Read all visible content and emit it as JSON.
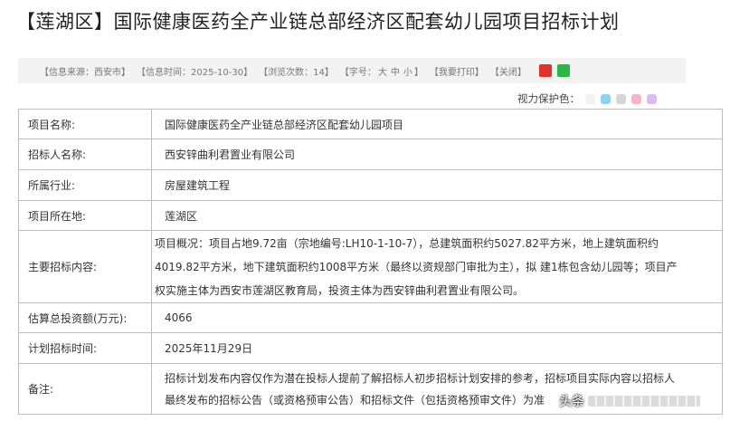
{
  "title": "【莲湖区】国际健康医药全产业链总部经济区配套幼儿园项目招标计划",
  "infobar": {
    "source": "【信息来源：西安市】",
    "time": "【信息时间：2025-10-30】",
    "views": "【浏览次数：14】",
    "font_prefix": "【字号：",
    "font_large": "大",
    "font_medium": "中",
    "font_small": "小",
    "font_suffix": "】",
    "print": "【我要打印】",
    "close": "【关闭】"
  },
  "eye_protect": {
    "label": "视力保护色：",
    "colors": [
      "#f2f2f2",
      "#8fd3ee",
      "#d6d6d6",
      "#f4b6c7",
      "#d9bdf2"
    ]
  },
  "table": {
    "rows": [
      {
        "label": "项目名称:",
        "value": "国际健康医药全产业链总部经济区配套幼儿园项目"
      },
      {
        "label": "招标人名称:",
        "value": "西安锌曲利君置业有限公司"
      },
      {
        "label": "所属行业:",
        "value": "房屋建筑工程"
      },
      {
        "label": "项目所在地:",
        "value": "莲湖区"
      },
      {
        "label": "主要招标内容:",
        "lines": [
          "项目概况：项目占地9.72亩（宗地编号:LH10-1-10-7），总建筑面积约5027.82平方米，地上建筑面积约",
          "4019.82平方米，地下建筑面积约1008平方米（最终以资规部门审批为主），拟 建1栋包含幼儿园等；项目产",
          "权实施主体为西安市莲湖区教育局，投资主体为西安锌曲利君置业有限公司。"
        ]
      },
      {
        "label": "估算总投资额(万元):",
        "value": "4066"
      },
      {
        "label": "计划招标时间:",
        "value": "2025年11月29日"
      },
      {
        "label": "备注:",
        "lines": [
          "招标计划发布内容仅作为潜在投标人提前了解招标人初步招标计划安排的参考，招标项目实际内容以招标人",
          "最终发布的招标公告（或资格预审公告）和招标文件（包括资格预审文件）为准"
        ]
      }
    ]
  },
  "watermark": {
    "text": "头条"
  }
}
